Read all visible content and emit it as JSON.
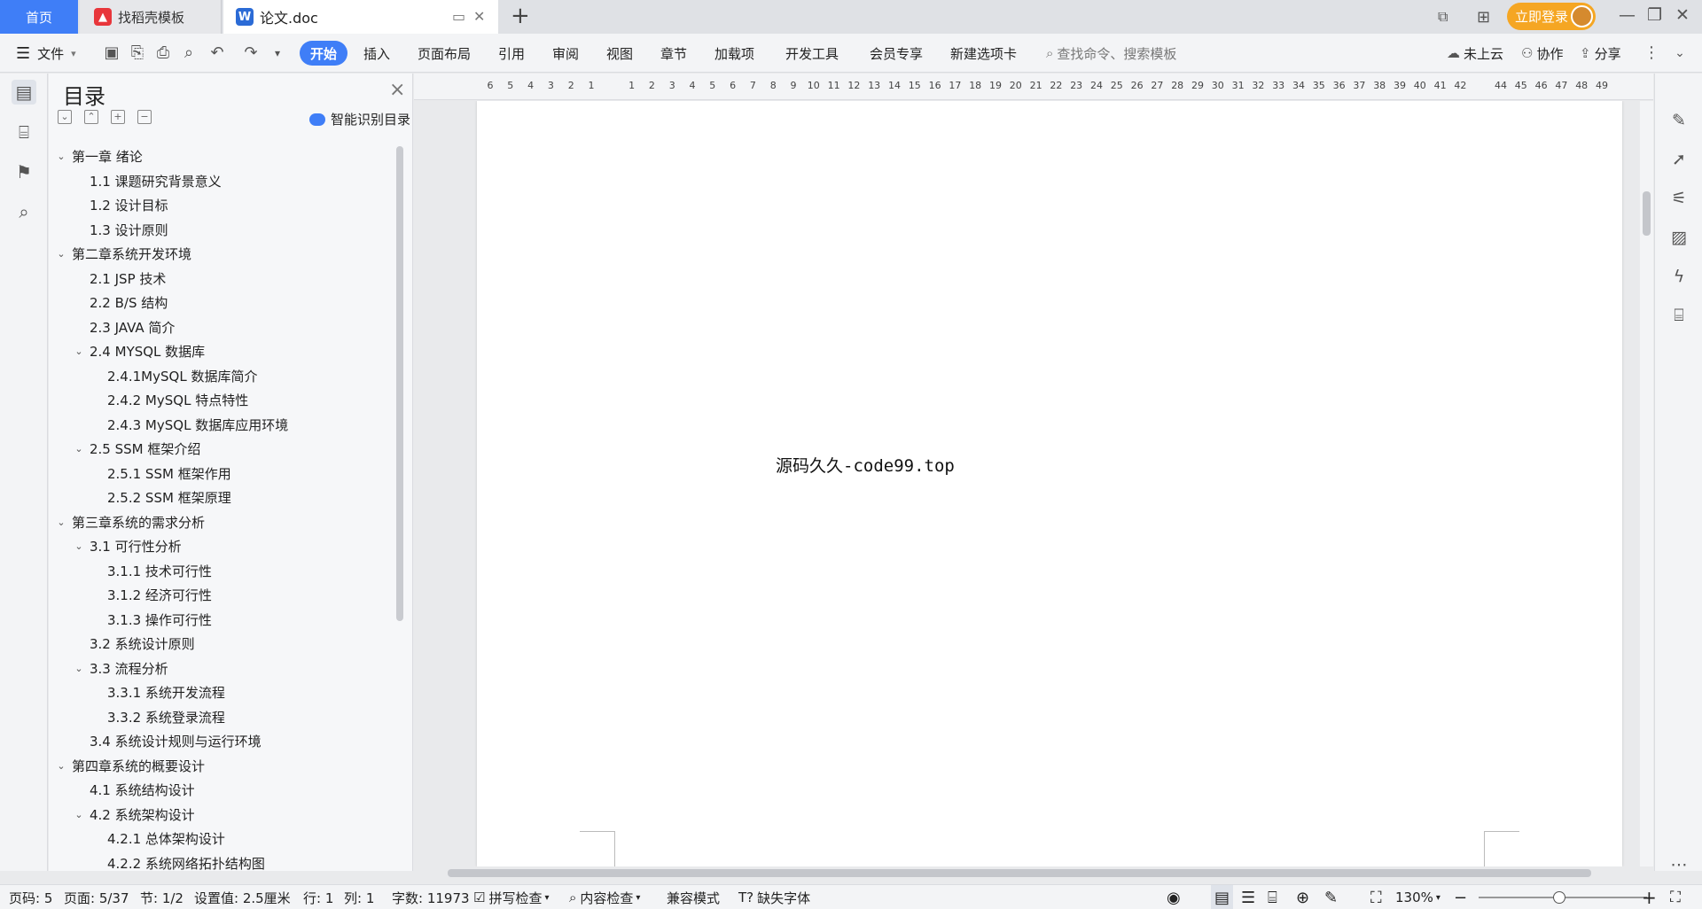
{
  "titlebar": {
    "tab_home": "首页",
    "tab_template": "找稻壳模板",
    "tab_doc": "论文.doc",
    "new_tab": "+",
    "login": "立即登录"
  },
  "ribbon": {
    "menu": "文件",
    "tabs": [
      "开始",
      "插入",
      "页面布局",
      "引用",
      "审阅",
      "视图",
      "章节",
      "加载项",
      "开发工具",
      "会员专享",
      "新建选项卡"
    ],
    "search_placeholder": "查找命令、搜索模板",
    "cloud": "未上云",
    "collab": "协作",
    "share": "分享"
  },
  "toc": {
    "title": "目录",
    "smart": "智能识别目录",
    "items": [
      {
        "text": "第一章  绪论",
        "level": 1,
        "chev": "v"
      },
      {
        "text": "1.1 课题研究背景意义",
        "level": 2,
        "chev": ""
      },
      {
        "text": "1.2 设计目标",
        "level": 2,
        "chev": ""
      },
      {
        "text": "1.3  设计原则",
        "level": 2,
        "chev": ""
      },
      {
        "text": "第二章系统开发环境",
        "level": 1,
        "chev": "v"
      },
      {
        "text": "2.1 JSP 技术",
        "level": 2,
        "chev": ""
      },
      {
        "text": "2.2 B/S 结构",
        "level": 2,
        "chev": ""
      },
      {
        "text": "2.3 JAVA 简介",
        "level": 2,
        "chev": ""
      },
      {
        "text": "2.4 MYSQL 数据库",
        "level": 2,
        "chev": "v"
      },
      {
        "text": "2.4.1MySQL 数据库简介",
        "level": 3,
        "chev": ""
      },
      {
        "text": "2.4.2 MySQL 特点特性",
        "level": 3,
        "chev": ""
      },
      {
        "text": "2.4.3 MySQL 数据库应用环境",
        "level": 3,
        "chev": ""
      },
      {
        "text": "2.5 SSM 框架介绍",
        "level": 2,
        "chev": "v"
      },
      {
        "text": "2.5.1 SSM 框架作用",
        "level": 3,
        "chev": ""
      },
      {
        "text": "2.5.2 SSM 框架原理",
        "level": 3,
        "chev": ""
      },
      {
        "text": "第三章系统的需求分析",
        "level": 1,
        "chev": "v"
      },
      {
        "text": "3.1 可行性分析",
        "level": 2,
        "chev": "v"
      },
      {
        "text": "3.1.1  技术可行性",
        "level": 3,
        "chev": ""
      },
      {
        "text": "3.1.2 经济可行性",
        "level": 3,
        "chev": ""
      },
      {
        "text": "3.1.3 操作可行性",
        "level": 3,
        "chev": ""
      },
      {
        "text": "3.2 系统设计原则",
        "level": 2,
        "chev": ""
      },
      {
        "text": "3.3 流程分析",
        "level": 2,
        "chev": "v"
      },
      {
        "text": "3.3.1  系统开发流程",
        "level": 3,
        "chev": ""
      },
      {
        "text": "3.3.2  系统登录流程",
        "level": 3,
        "chev": ""
      },
      {
        "text": "3.4 系统设计规则与运行环境",
        "level": 2,
        "chev": ""
      },
      {
        "text": "第四章系统的概要设计",
        "level": 1,
        "chev": "v"
      },
      {
        "text": "4.1  系统结构设计",
        "level": 2,
        "chev": ""
      },
      {
        "text": "4.2  系统架构设计",
        "level": 2,
        "chev": "v"
      },
      {
        "text": "4.2.1 总体架构设计",
        "level": 3,
        "chev": ""
      },
      {
        "text": "4.2.2 系统网络拓扑结构图",
        "level": 3,
        "chev": ""
      }
    ]
  },
  "ruler": {
    "numbers": [
      "6",
      "5",
      "4",
      "3",
      "2",
      "1",
      "",
      "1",
      "2",
      "3",
      "4",
      "5",
      "6",
      "7",
      "8",
      "9",
      "10",
      "11",
      "12",
      "13",
      "14",
      "15",
      "16",
      "17",
      "18",
      "19",
      "20",
      "21",
      "22",
      "23",
      "24",
      "25",
      "26",
      "27",
      "28",
      "29",
      "30",
      "31",
      "32",
      "33",
      "34",
      "35",
      "36",
      "37",
      "38",
      "39",
      "40",
      "41",
      "42",
      "",
      "44",
      "45",
      "46",
      "47",
      "48",
      "49"
    ]
  },
  "document": {
    "text": "源码久久-code99.top"
  },
  "status": {
    "page_code": "页码: 5",
    "page": "页面: 5/37",
    "section": "节: 1/2",
    "setting": "设置值: 2.5厘米",
    "row": "行: 1",
    "col": "列: 1",
    "words": "字数: 11973",
    "spell": "拼写检查",
    "content_check": "内容检查",
    "compat": "兼容模式",
    "missing_font": "缺失字体",
    "zoom": "130%",
    "zoom_level_percent": 130
  }
}
